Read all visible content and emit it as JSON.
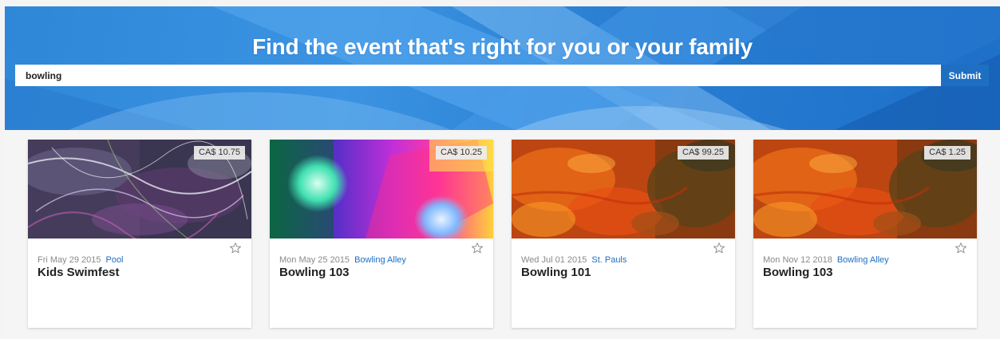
{
  "hero": {
    "title": "Find the event that's right for you or your family"
  },
  "search": {
    "value": "bowling",
    "placeholder": "",
    "submit_label": "Submit"
  },
  "events": [
    {
      "price": "CA$ 10.75",
      "date": "Fri May 29 2015",
      "venue": "Pool",
      "title": "Kids Swimfest",
      "image": "abstract-swirl"
    },
    {
      "price": "CA$ 10.25",
      "date": "Mon May 25 2015",
      "venue": "Bowling Alley",
      "title": "Bowling 103",
      "image": "colorful-lights"
    },
    {
      "price": "CA$ 99.25",
      "date": "Wed Jul 01 2015",
      "venue": "St. Pauls",
      "title": "Bowling 101",
      "image": "orange-texture"
    },
    {
      "price": "CA$ 1.25",
      "date": "Mon Nov 12 2018",
      "venue": "Bowling Alley",
      "title": "Bowling 103",
      "image": "orange-texture"
    }
  ],
  "colors": {
    "accent": "#1e6fc2",
    "hero": "#2f87d8",
    "price_badge": "#eeeeee"
  },
  "icons": {
    "favorite": "star-outline-icon"
  }
}
